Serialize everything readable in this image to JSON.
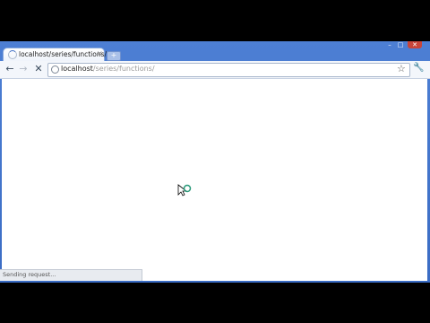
{
  "browser": {
    "tab": {
      "title": "localhost/series/functions/",
      "close_glyph": "×"
    },
    "new_tab_glyph": "+",
    "window_controls": {
      "minimize": "–",
      "maximize": "□",
      "close": "✕"
    },
    "nav": {
      "back_glyph": "←",
      "forward_glyph": "→",
      "stop_glyph": "✕"
    },
    "omnibox": {
      "host": "localhost",
      "path": "/series/functions/"
    },
    "bookmark_glyph": "☆",
    "menu_glyph": "🔧"
  },
  "status_bar": {
    "text": "Sending request..."
  },
  "colors": {
    "frame": "#3a6cc4",
    "content": "#ffffff",
    "letterbox": "#000000"
  }
}
